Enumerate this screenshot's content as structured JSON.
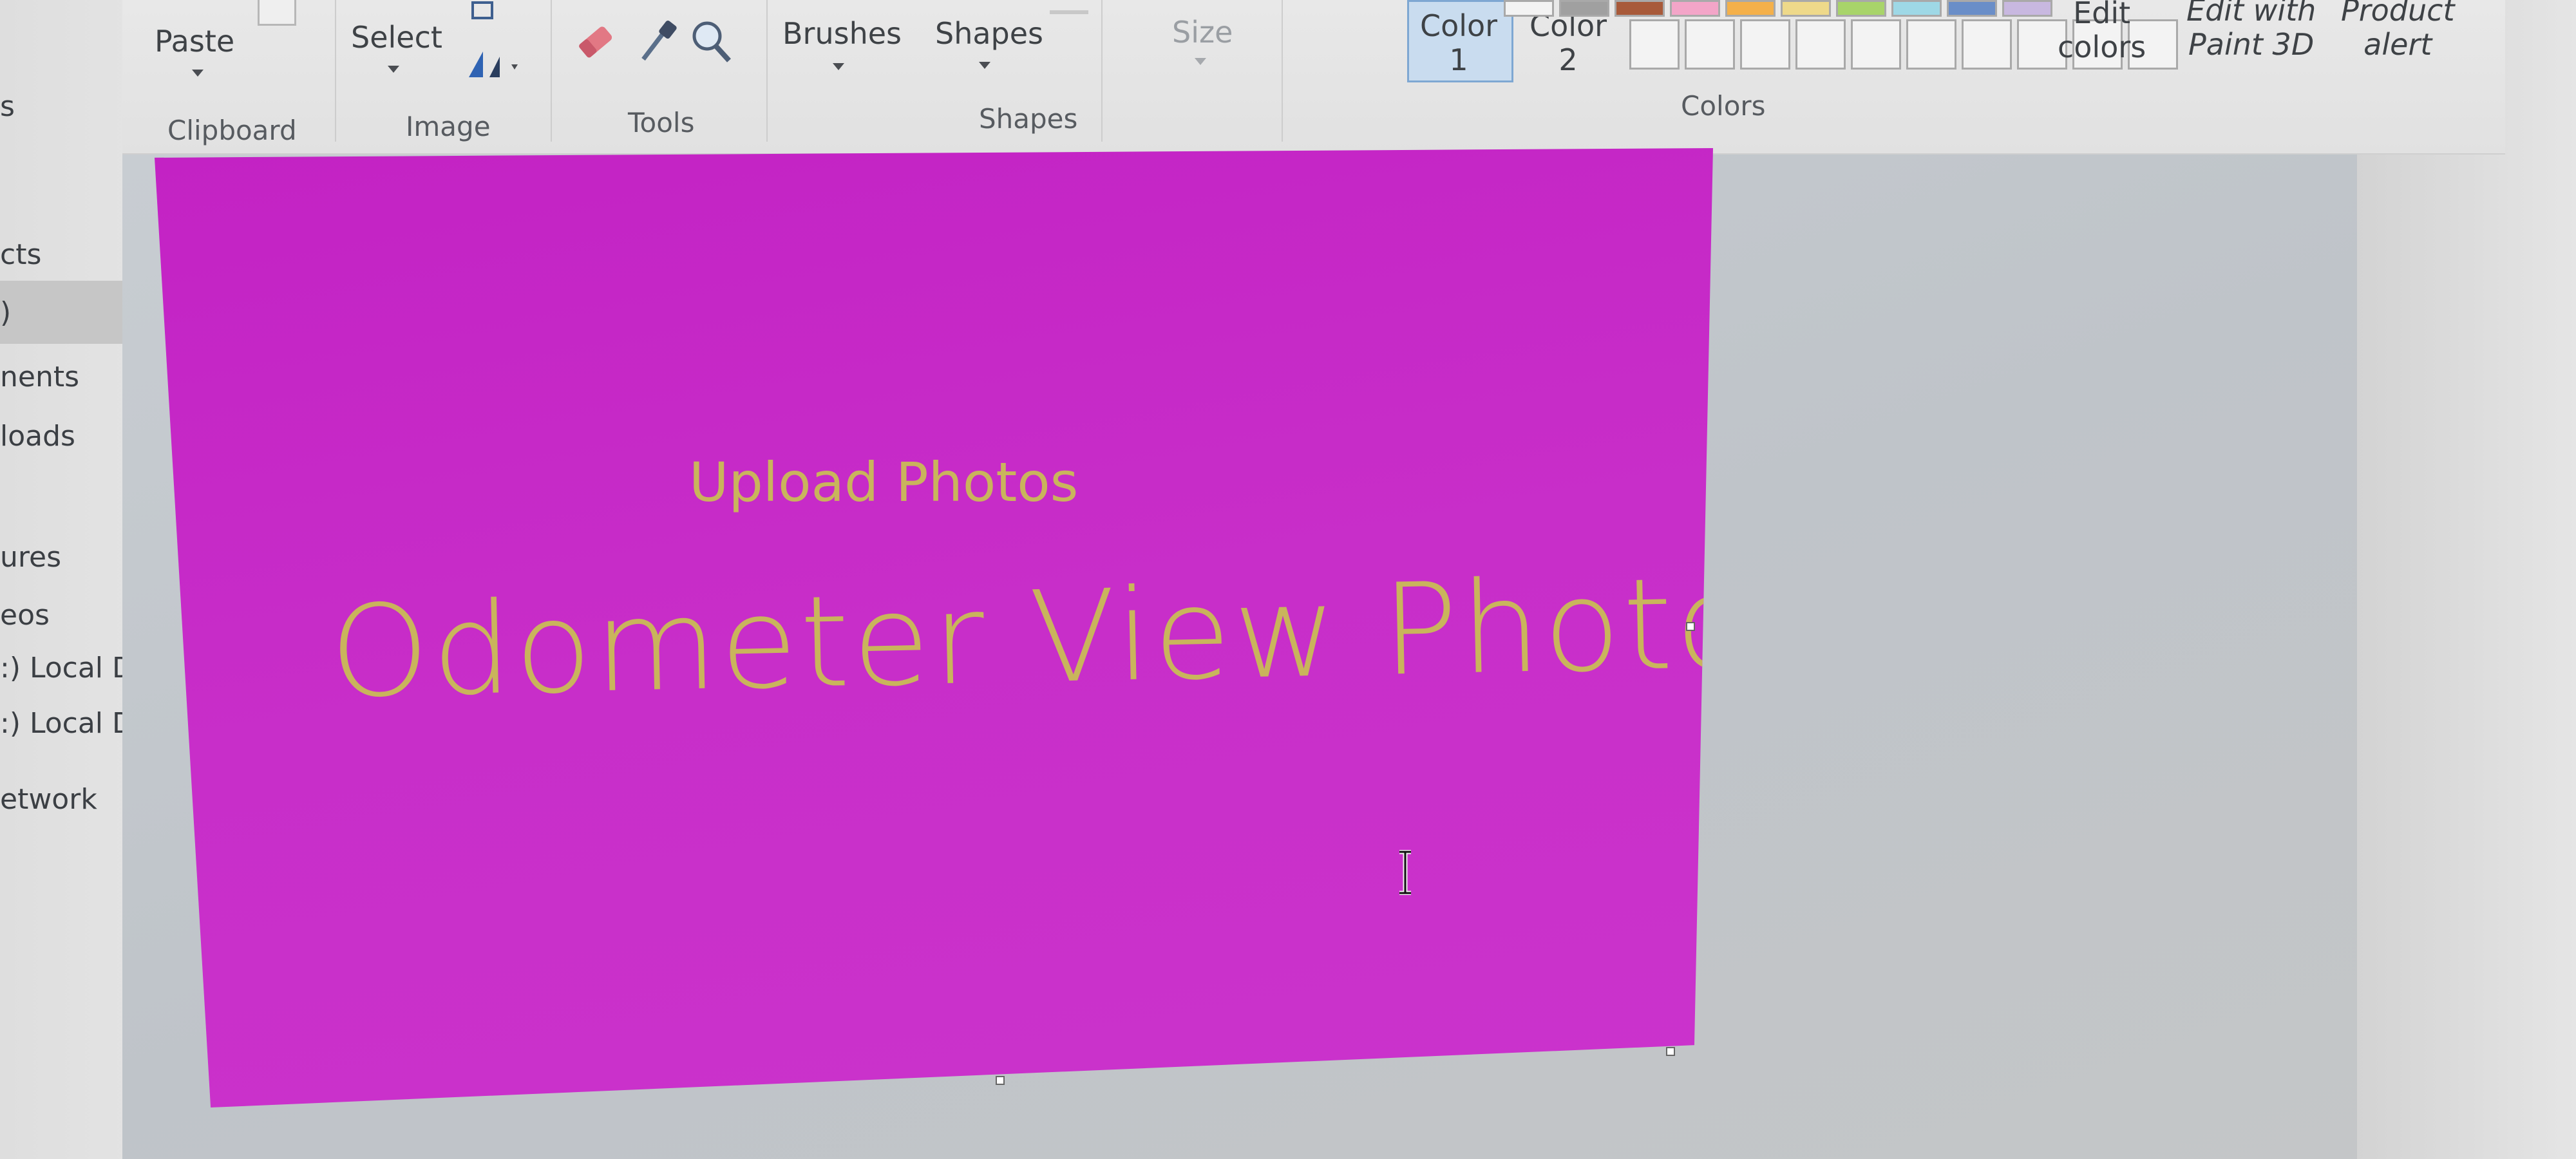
{
  "nav": {
    "items": [
      {
        "label": "s"
      },
      {
        "label": "cts"
      },
      {
        "label": ")"
      },
      {
        "label": "nents"
      },
      {
        "label": "loads"
      },
      {
        "label": "ures"
      },
      {
        "label": "eos"
      },
      {
        "label": ":) Local Disk"
      },
      {
        "label": ":) Local Disk"
      },
      {
        "label": "etwork"
      }
    ]
  },
  "ribbon": {
    "paste_label": "Paste",
    "select_label": "Select",
    "brushes_label": "Brushes",
    "shapes_label": "Shapes",
    "size_label": "Size",
    "color1_label": "Color\n1",
    "color2_label": "Color\n2",
    "edit_colors_label": "Edit\ncolors",
    "edit_paint3d_label": "Edit with\nPaint 3D",
    "product_alert_label": "Product\nalert",
    "groups": {
      "clipboard": "Clipboard",
      "image": "Image",
      "tools": "Tools",
      "shapes": "Shapes",
      "colors": "Colors"
    }
  },
  "canvas": {
    "background_color": "#c82ec9",
    "text_color": "#c9b45c",
    "heading": "Upload Photos",
    "title": "Odometer View Photo"
  },
  "icons": {
    "eraser": "eraser-icon",
    "picker": "color-picker-icon",
    "magnifier": "magnifier-icon",
    "rotate": "rotate-icon",
    "cursor": "text-cursor-icon"
  }
}
